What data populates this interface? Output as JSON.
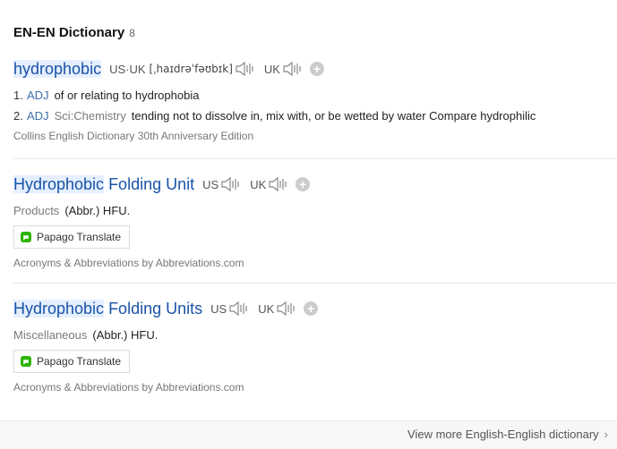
{
  "header": {
    "title": "EN-EN Dictionary",
    "count": "8"
  },
  "entries": [
    {
      "headword": "hydrophobic",
      "pron_label": "US·UK",
      "ipa": "[ˌhaɪdrəˈfəʊbɪk]",
      "uk_label": "UK",
      "senses": [
        {
          "num": "1.",
          "pos": "ADJ",
          "field": "",
          "def": "of or relating to hydrophobia"
        },
        {
          "num": "2.",
          "pos": "ADJ",
          "field": "Sci:Chemistry",
          "def": "tending not to dissolve in, mix with, or be wetted by water Compare hydrophilic"
        }
      ],
      "source": "Collins English Dictionary 30th Anniversary Edition"
    },
    {
      "headword_hl": "Hydrophobic",
      "headword_rest": " Folding Unit",
      "us_label": "US",
      "uk_label": "UK",
      "category": "Products",
      "value": "(Abbr.) HFU.",
      "translate_label": "Papago Translate",
      "source": "Acronyms & Abbreviations by Abbreviations.com"
    },
    {
      "headword_hl": "Hydrophobic",
      "headword_rest": " Folding Units",
      "us_label": "US",
      "uk_label": "UK",
      "category": "Miscellaneous",
      "value": "(Abbr.) HFU.",
      "translate_label": "Papago Translate",
      "source": "Acronyms & Abbreviations by Abbreviations.com"
    }
  ],
  "footer": {
    "more_label": "View more English-English dictionary"
  },
  "colors": {
    "headword": "#1a53a8",
    "highlight": "#e5efff",
    "pos": "#3e6fb0"
  }
}
